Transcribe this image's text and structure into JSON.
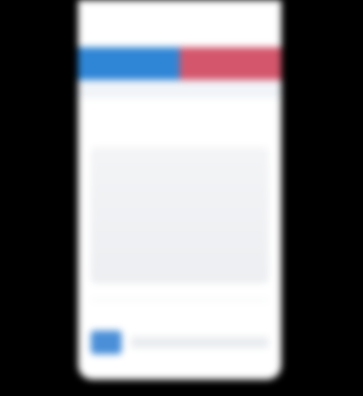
{
  "colors": {
    "tab_left": "#2f86d6",
    "tab_right": "#d4566c",
    "link": "#6e9fd6"
  },
  "tabs": [
    {
      "label": ""
    },
    {
      "label": ""
    }
  ],
  "content": {
    "link_text": "",
    "body_text": ""
  },
  "footer": {
    "icon": "app-icon",
    "text": ""
  }
}
